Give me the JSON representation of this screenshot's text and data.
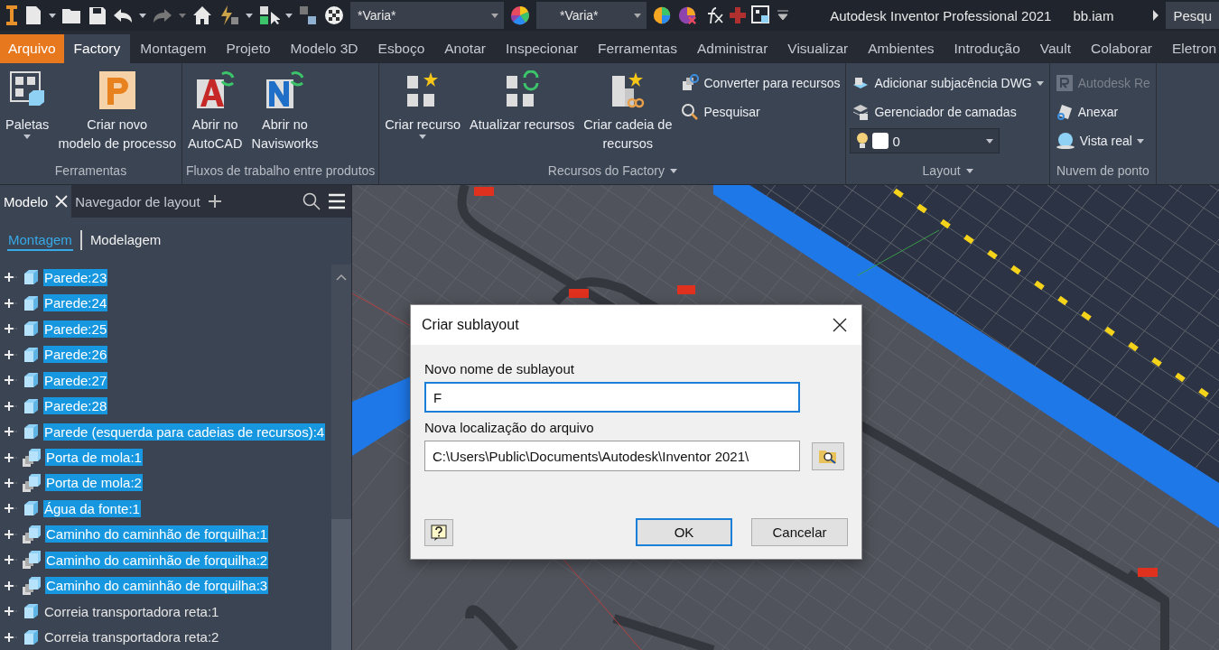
{
  "quick_access": {
    "style_combo": "*Varia*",
    "appearance_combo": "*Varia*"
  },
  "window": {
    "title": "Autodesk Inventor Professional 2021",
    "file": "bb.iam",
    "search": "Pesqu"
  },
  "ribbon_tabs": [
    {
      "label": "Arquivo",
      "kind": "file",
      "selected": false
    },
    {
      "label": "Factory",
      "kind": "tab",
      "selected": true
    },
    {
      "label": "Montagem",
      "kind": "tab",
      "selected": false
    },
    {
      "label": "Projeto",
      "kind": "tab",
      "selected": false
    },
    {
      "label": "Modelo 3D",
      "kind": "tab",
      "selected": false
    },
    {
      "label": "Esboço",
      "kind": "tab",
      "selected": false
    },
    {
      "label": "Anotar",
      "kind": "tab",
      "selected": false
    },
    {
      "label": "Inspecionar",
      "kind": "tab",
      "selected": false
    },
    {
      "label": "Ferramentas",
      "kind": "tab",
      "selected": false
    },
    {
      "label": "Administrar",
      "kind": "tab",
      "selected": false
    },
    {
      "label": "Visualizar",
      "kind": "tab",
      "selected": false
    },
    {
      "label": "Ambientes",
      "kind": "tab",
      "selected": false
    },
    {
      "label": "Introdução",
      "kind": "tab",
      "selected": false
    },
    {
      "label": "Vault",
      "kind": "tab",
      "selected": false
    },
    {
      "label": "Colaborar",
      "kind": "tab",
      "selected": false
    },
    {
      "label": "Eletron",
      "kind": "tab",
      "selected": false
    }
  ],
  "ribbon_panels": [
    {
      "title": "Ferramentas",
      "menu": false,
      "controls": [
        {
          "kind": "large",
          "lines": [
            "Paletas"
          ],
          "dropdown": true
        },
        {
          "kind": "large",
          "lines": [
            "Criar novo",
            "modelo de processo"
          ],
          "dropdown": false
        }
      ]
    },
    {
      "title": "Fluxos de trabalho entre produtos",
      "menu": false,
      "controls": [
        {
          "kind": "large",
          "lines": [
            "Abrir no",
            "AutoCAD"
          ],
          "dropdown": false
        },
        {
          "kind": "large",
          "lines": [
            "Abrir no",
            "Navisworks"
          ],
          "dropdown": false
        }
      ]
    },
    {
      "title": "Recursos do Factory",
      "menu": true,
      "controls": [
        {
          "kind": "large",
          "lines": [
            "Criar recurso"
          ],
          "dropdown": true
        },
        {
          "kind": "large",
          "lines": [
            "Atualizar recursos"
          ],
          "dropdown": false
        },
        {
          "kind": "large",
          "lines": [
            "Criar cadeia de",
            "recursos"
          ],
          "dropdown": false
        },
        {
          "kind": "small",
          "label": "Converter para recursos",
          "dropdown": false,
          "disabled": false
        },
        {
          "kind": "small",
          "label": "Pesquisar",
          "dropdown": false,
          "disabled": false
        }
      ]
    },
    {
      "title": "Layout",
      "menu": true,
      "controls": [
        {
          "kind": "small",
          "label": "Adicionar subjacência DWG",
          "dropdown": true,
          "disabled": false
        },
        {
          "kind": "small",
          "label": "Gerenciador de camadas",
          "dropdown": false,
          "disabled": false
        },
        {
          "kind": "combo",
          "value": "0"
        }
      ]
    },
    {
      "title": "Nuvem de ponto",
      "menu": false,
      "controls": [
        {
          "kind": "small",
          "label": "Autodesk Re",
          "dropdown": false,
          "disabled": true
        },
        {
          "kind": "small",
          "label": "Anexar",
          "dropdown": false,
          "disabled": false
        },
        {
          "kind": "small",
          "label": "Vista real",
          "dropdown": true,
          "disabled": false
        }
      ]
    }
  ],
  "browser": {
    "tabs": [
      {
        "label": "Modelo",
        "selected": true,
        "closable": true
      },
      {
        "label": "Navegador de layout",
        "selected": false,
        "closable": false
      }
    ],
    "views": [
      {
        "label": "Montagem",
        "selected": true
      },
      {
        "label": "Modelagem",
        "selected": false
      }
    ],
    "items": [
      {
        "label": "Parede:23",
        "kind": "part",
        "selected": true
      },
      {
        "label": "Parede:24",
        "kind": "part",
        "selected": true
      },
      {
        "label": "Parede:25",
        "kind": "part",
        "selected": true
      },
      {
        "label": "Parede:26",
        "kind": "part",
        "selected": true
      },
      {
        "label": "Parede:27",
        "kind": "part",
        "selected": true
      },
      {
        "label": "Parede:28",
        "kind": "part",
        "selected": true
      },
      {
        "label": "Parede (esquerda para cadeias de recursos):4",
        "kind": "part",
        "selected": true
      },
      {
        "label": "Porta de mola:1",
        "kind": "assembly",
        "selected": true
      },
      {
        "label": "Porta de mola:2",
        "kind": "assembly",
        "selected": true
      },
      {
        "label": "Água da fonte:1",
        "kind": "part",
        "selected": true
      },
      {
        "label": "Caminho do caminhão de forquilha:1",
        "kind": "assembly",
        "selected": true
      },
      {
        "label": "Caminho do caminhão de forquilha:2",
        "kind": "assembly",
        "selected": true
      },
      {
        "label": "Caminho do caminhão de forquilha:3",
        "kind": "assembly",
        "selected": true
      },
      {
        "label": "Correia transportadora reta:1",
        "kind": "part",
        "selected": false
      },
      {
        "label": "Correia transportadora reta:2",
        "kind": "part",
        "selected": false
      }
    ]
  },
  "dialog": {
    "title": "Criar sublayout",
    "fields": [
      {
        "label": "Novo nome de sublayout",
        "value": "F",
        "focused": true,
        "browse": false
      },
      {
        "label": "Nova localização do arquivo",
        "value": "C:\\Users\\Public\\Documents\\Autodesk\\Inventor 2021\\",
        "focused": false,
        "browse": true
      }
    ],
    "buttons": [
      {
        "label": "OK",
        "default": true
      },
      {
        "label": "Cancelar",
        "default": false
      }
    ]
  }
}
